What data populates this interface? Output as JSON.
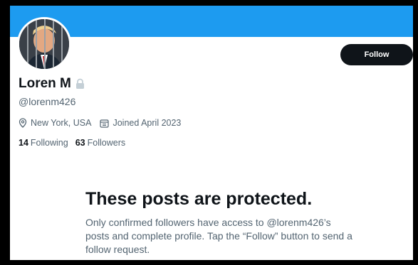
{
  "profile": {
    "display_name": "Loren M",
    "handle": "@lorenm426",
    "location": "New York, USA",
    "joined": "Joined April 2023",
    "following_count": "14",
    "following_label": "Following",
    "followers_count": "63",
    "followers_label": "Followers"
  },
  "actions": {
    "follow_label": "Follow"
  },
  "protected": {
    "title": "These posts are protected.",
    "body": "Only confirmed followers have access to @lorenm426’s posts and complete profile. Tap the “Follow” button to send a follow request."
  },
  "colors": {
    "banner": "#1d9bf0",
    "button": "#0f1419",
    "secondary_text": "#536471"
  },
  "icons": [
    "lock-icon",
    "location-pin-icon",
    "calendar-icon"
  ]
}
